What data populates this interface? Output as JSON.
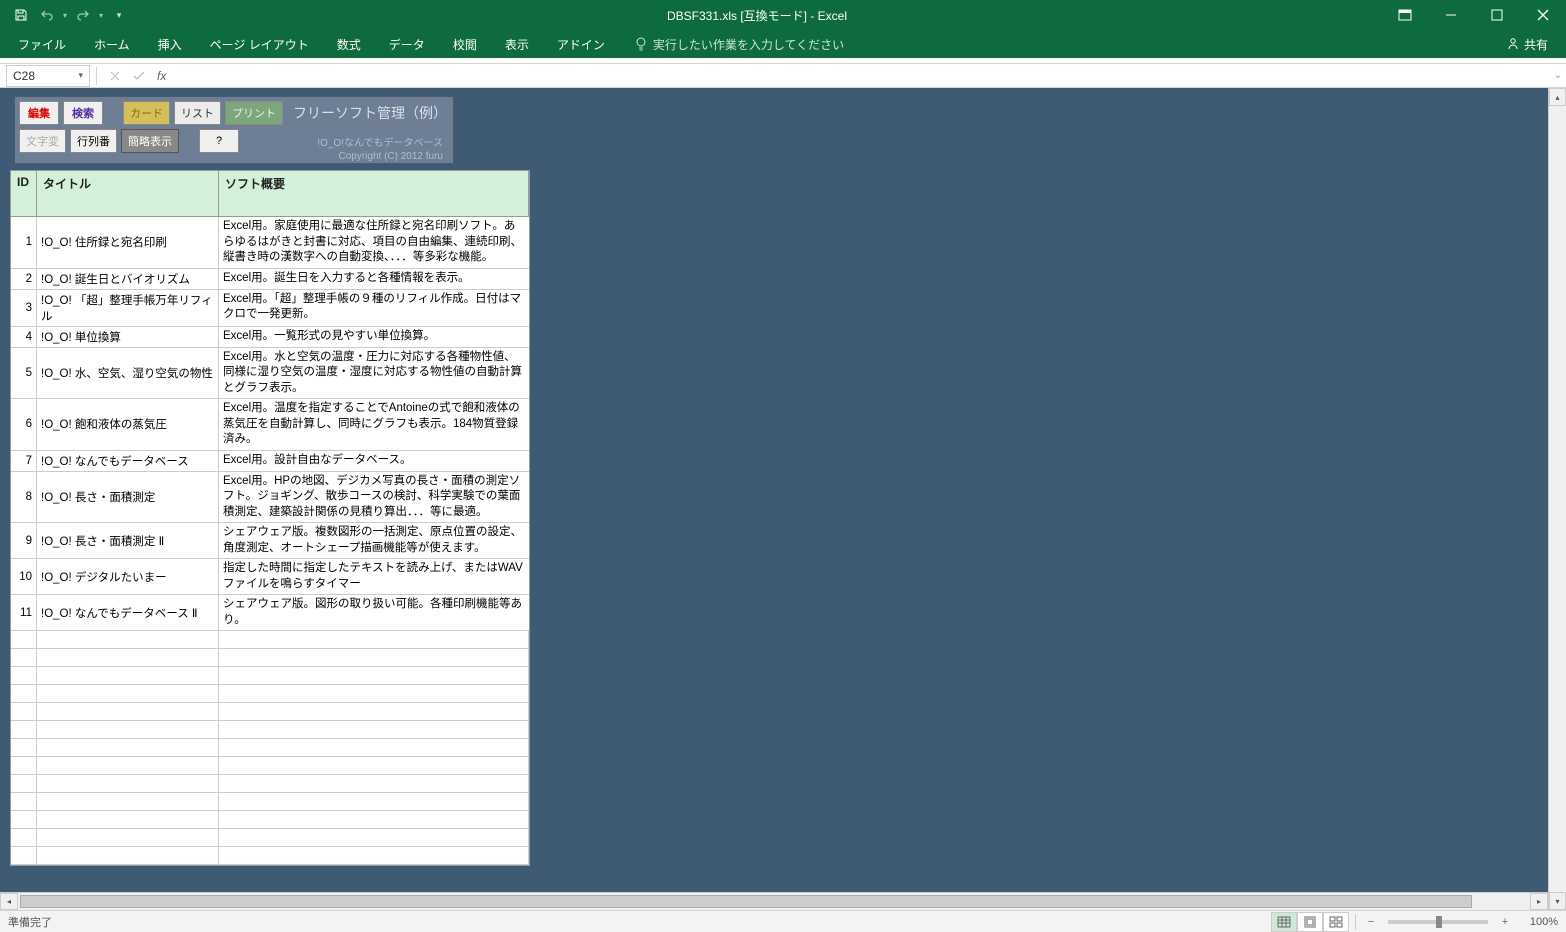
{
  "titlebar": {
    "title": "DBSF331.xls  [互換モード] - Excel"
  },
  "ribbon": {
    "tabs": [
      "ファイル",
      "ホーム",
      "挿入",
      "ページ レイアウト",
      "数式",
      "データ",
      "校閲",
      "表示",
      "アドイン"
    ],
    "tellme": "実行したい作業を入力してください",
    "share": "共有"
  },
  "formula": {
    "name_box": "C28",
    "value": ""
  },
  "panel": {
    "btn_edit": "編集",
    "btn_search": "検索",
    "tab_card": "カード",
    "tab_list": "リスト",
    "tab_print": "プリント",
    "btn_moji": "文字変",
    "btn_rowcol": "行列番",
    "btn_summary": "簡略表示",
    "btn_help": "?",
    "title": "フリーソフト管理（例）",
    "credit1": "!O_O!なんでもデータベース",
    "credit2": "Copyright (C) 2012 furu"
  },
  "table": {
    "headers": {
      "id": "ID",
      "title": "タイトル",
      "desc": "ソフト概要"
    },
    "rows": [
      {
        "id": "1",
        "title": "!O_O! 住所録と宛名印刷",
        "desc": "Excel用。家庭使用に最適な住所録と宛名印刷ソフト。あらゆるはがきと封書に対応、項目の自由編集、連続印刷、縦書き時の漢数字への自動変換、．．．等多彩な機能。"
      },
      {
        "id": "2",
        "title": "!O_O! 誕生日とバイオリズム",
        "desc": "Excel用。誕生日を入力すると各種情報を表示。"
      },
      {
        "id": "3",
        "title": "!O_O! 「超」整理手帳万年リフィル",
        "desc": "Excel用。「超」整理手帳の９種のリフィル作成。日付はマクロで一発更新。"
      },
      {
        "id": "4",
        "title": "!O_O! 単位換算",
        "desc": "Excel用。一覧形式の見やすい単位換算。"
      },
      {
        "id": "5",
        "title": "!O_O! 水、空気、湿り空気の物性",
        "desc": "Excel用。水と空気の温度・圧力に対応する各種物性値、同様に湿り空気の温度・湿度に対応する物性値の自動計算とグラフ表示。"
      },
      {
        "id": "6",
        "title": "!O_O! 飽和液体の蒸気圧",
        "desc": "Excel用。温度を指定することでAntoineの式で飽和液体の蒸気圧を自動計算し、同時にグラフも表示。184物質登録済み。"
      },
      {
        "id": "7",
        "title": "!O_O! なんでもデータベース",
        "desc": "Excel用。設計自由なデータベース。"
      },
      {
        "id": "8",
        "title": "!O_O! 長さ・面積測定",
        "desc": "Excel用。HPの地図、デジカメ写真の長さ・面積の測定ソフト。ジョギング、散歩コースの検討、科学実験での葉面積測定、建築設計関係の見積り算出．．．等に最適。"
      },
      {
        "id": "9",
        "title": "!O_O! 長さ・面積測定 Ⅱ",
        "desc": "シェアウェア版。複数図形の一括測定、原点位置の設定、角度測定、オートシェープ描画機能等が使えます。"
      },
      {
        "id": "10",
        "title": "!O_O! デジタルたいまー",
        "desc": "指定した時間に指定したテキストを読み上げ、またはWAVファイルを鳴らすタイマー"
      },
      {
        "id": "11",
        "title": "!O_O! なんでもデータベース Ⅱ",
        "desc": "シェアウェア版。図形の取り扱い可能。各種印刷機能等あり。"
      }
    ]
  },
  "statusbar": {
    "ready": "準備完了",
    "zoom": "100%"
  }
}
